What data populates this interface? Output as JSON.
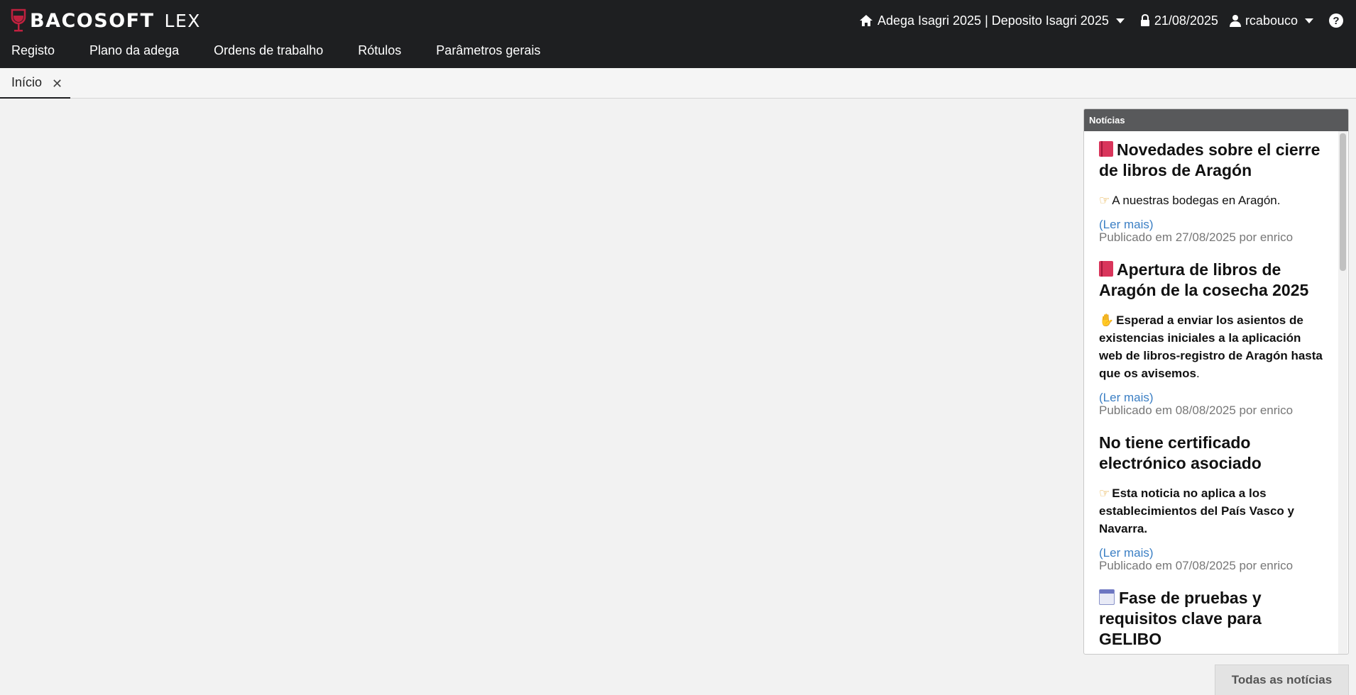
{
  "app": {
    "logo_text": "BACOSOFT",
    "logo_sub": "LEX",
    "logo_icon": "wine-glass-icon"
  },
  "header": {
    "context_label": "Adega Isagri 2025 | Deposito Isagri 2025",
    "date": "21/08/2025",
    "username": "rcabouco",
    "icons": {
      "context": "home-icon",
      "date": "lock-icon",
      "user": "user-icon",
      "help": "help-icon"
    },
    "help_symbol": "?"
  },
  "nav": {
    "items": [
      {
        "label": "Registo"
      },
      {
        "label": "Plano da adega"
      },
      {
        "label": "Ordens de trabalho"
      },
      {
        "label": "Rótulos"
      },
      {
        "label": "Parâmetros gerais"
      }
    ]
  },
  "tabs": [
    {
      "label": "Início",
      "close": "✕"
    }
  ],
  "news": {
    "header": "Notícias",
    "items": [
      {
        "icon": "book-icon",
        "title": "Novedades sobre el cierre de libros de Aragón",
        "desc_icon": "pointing-hand-icon",
        "desc": "A nuestras bodegas en Aragón.",
        "more": "(Ler mais)",
        "meta": "Publicado em 27/08/2025 por enrico"
      },
      {
        "icon": "book-icon",
        "title": "Apertura de libros de Aragón de la cosecha 2025",
        "desc_icon": "raised-hand-icon",
        "desc": "Esperad a enviar los asientos de existencias iniciales a la aplicación web de libros-registro de Aragón hasta que os avisemos",
        "desc_tail": ".",
        "more": "(Ler mais)",
        "meta": "Publicado em 08/08/2025 por enrico"
      },
      {
        "icon": "",
        "title": "No tiene certificado electrónico asociado",
        "desc_icon": "pointing-hand-icon",
        "desc": "Esta noticia no aplica a los establecimientos del País Vasco y Navarra.",
        "more": "(Ler mais)",
        "meta": "Publicado em 07/08/2025 por enrico"
      },
      {
        "icon": "calendar-icon",
        "title": "Fase de pruebas y requisitos clave para GELIBO"
      }
    ],
    "all_news_button": "Todas as notícias"
  }
}
